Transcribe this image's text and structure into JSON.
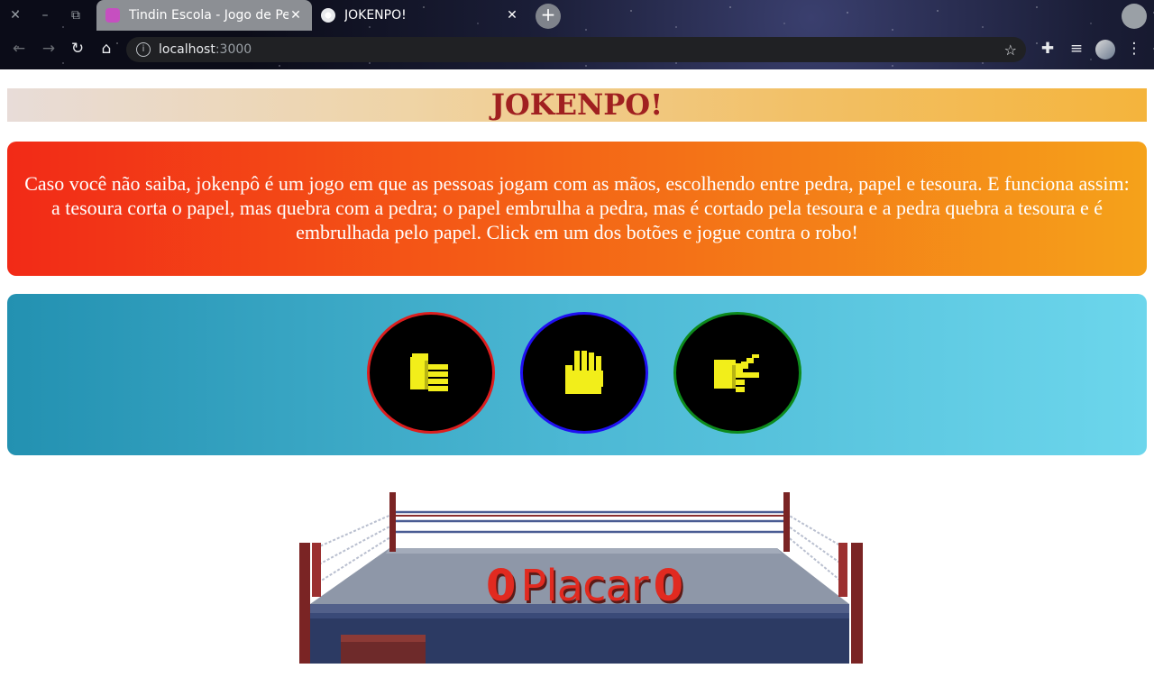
{
  "browser": {
    "tabs": [
      {
        "title": "Tindin Escola - Jogo de Pedra",
        "active": false
      },
      {
        "title": "JOKENPO!",
        "active": true
      }
    ],
    "url_host": "localhost",
    "url_port": ":3000"
  },
  "page": {
    "title": "JOKENPO!",
    "intro": "Caso você não saiba, jokenpô é um jogo em que as pessoas jogam com as mãos, escolhendo entre pedra, papel e tesoura. E funciona assim: a tesoura corta o papel, mas quebra com a pedra; o papel embrulha a pedra, mas é cortado pela tesoura e a pedra quebra a tesoura e é embrulhada pelo papel. Click em um dos botões e jogue contra o robo!",
    "choices": [
      {
        "icon": "pixel-fist-icon",
        "border_color": "#dc1e1e"
      },
      {
        "icon": "pixel-open-hand-icon",
        "border_color": "#1f10f2"
      },
      {
        "icon": "pixel-scissors-hand-icon",
        "border_color": "#0d8a1c"
      }
    ],
    "score": {
      "player": "0",
      "label": "Placar",
      "robot": "0"
    }
  },
  "colors": {
    "title_text": "#a02020",
    "icon_yellow": "#f2ee1a",
    "score_red": "#e12a20"
  }
}
